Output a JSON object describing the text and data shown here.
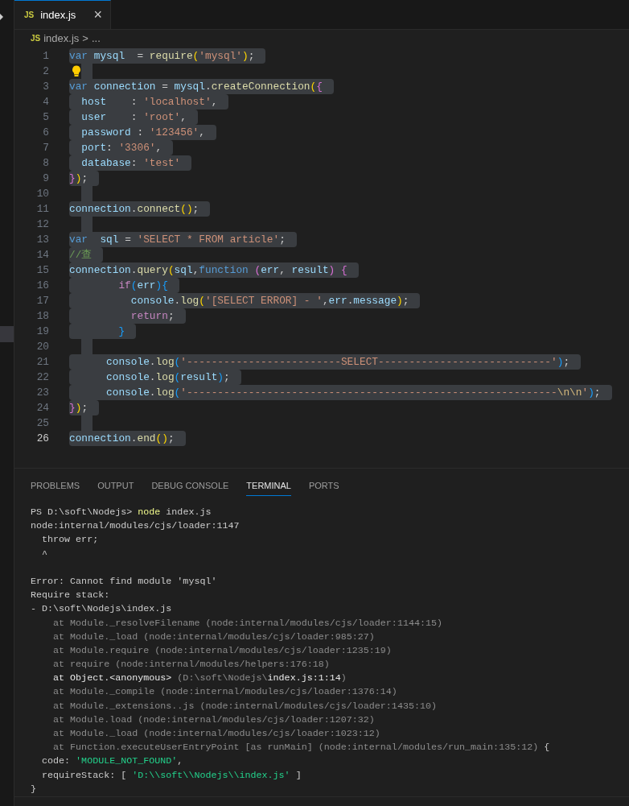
{
  "tab": {
    "label": "index.js",
    "badge": "JS",
    "close": "×",
    "selected": true
  },
  "breadcrumb": {
    "badge": "JS",
    "file": "index.js",
    "sep": ">",
    "rest": "..."
  },
  "editor": {
    "selection": true,
    "lines": [
      {
        "n": "1",
        "active": false,
        "t": [
          {
            "kind": "kw",
            "text": "var "
          },
          {
            "kind": "var",
            "text": "mysql"
          },
          {
            "kind": "p",
            "text": "  = "
          },
          {
            "kind": "fn",
            "text": "require"
          },
          {
            "kind": "b1",
            "text": "("
          },
          {
            "kind": "str",
            "text": "'mysql'"
          },
          {
            "kind": "b1",
            "text": ")"
          },
          {
            "kind": "p",
            "text": ";"
          }
        ]
      },
      {
        "n": "2",
        "active": false,
        "lightbulb": true
      },
      {
        "n": "3",
        "active": false,
        "t": [
          {
            "kind": "kw",
            "text": "var "
          },
          {
            "kind": "var",
            "text": "connection"
          },
          {
            "kind": "p",
            "text": " = "
          },
          {
            "kind": "var",
            "text": "mysql"
          },
          {
            "kind": "p",
            "text": "."
          },
          {
            "kind": "fn",
            "text": "createConnection"
          },
          {
            "kind": "b1",
            "text": "("
          },
          {
            "kind": "b2",
            "text": "{"
          }
        ]
      },
      {
        "n": "4",
        "active": false,
        "t": [
          {
            "kind": "var",
            "text": "  host"
          },
          {
            "kind": "p",
            "text": "    : "
          },
          {
            "kind": "str",
            "text": "'localhost'"
          },
          {
            "kind": "p",
            "text": ","
          }
        ]
      },
      {
        "n": "5",
        "active": false,
        "t": [
          {
            "kind": "var",
            "text": "  user"
          },
          {
            "kind": "p",
            "text": "    : "
          },
          {
            "kind": "str",
            "text": "'root'"
          },
          {
            "kind": "p",
            "text": ","
          }
        ]
      },
      {
        "n": "6",
        "active": false,
        "t": [
          {
            "kind": "var",
            "text": "  password"
          },
          {
            "kind": "p",
            "text": " : "
          },
          {
            "kind": "str",
            "text": "'123456'"
          },
          {
            "kind": "p",
            "text": ","
          }
        ]
      },
      {
        "n": "7",
        "active": false,
        "t": [
          {
            "kind": "var",
            "text": "  port"
          },
          {
            "kind": "p",
            "text": ": "
          },
          {
            "kind": "str",
            "text": "'3306'"
          },
          {
            "kind": "p",
            "text": ","
          }
        ]
      },
      {
        "n": "8",
        "active": false,
        "t": [
          {
            "kind": "var",
            "text": "  database"
          },
          {
            "kind": "p",
            "text": ": "
          },
          {
            "kind": "str",
            "text": "'test'"
          }
        ]
      },
      {
        "n": "9",
        "active": false,
        "t": [
          {
            "kind": "b2",
            "text": "}"
          },
          {
            "kind": "b1",
            "text": ")"
          },
          {
            "kind": "p",
            "text": ";"
          }
        ]
      },
      {
        "n": "10",
        "active": false
      },
      {
        "n": "11",
        "active": false,
        "t": [
          {
            "kind": "var",
            "text": "connection"
          },
          {
            "kind": "p",
            "text": "."
          },
          {
            "kind": "fn",
            "text": "connect"
          },
          {
            "kind": "b1",
            "text": "()"
          },
          {
            "kind": "p",
            "text": ";"
          }
        ]
      },
      {
        "n": "12",
        "active": false
      },
      {
        "n": "13",
        "active": false,
        "t": [
          {
            "kind": "kw",
            "text": "var  "
          },
          {
            "kind": "var",
            "text": "sql"
          },
          {
            "kind": "p",
            "text": " = "
          },
          {
            "kind": "str",
            "text": "'SELECT * FROM article'"
          },
          {
            "kind": "p",
            "text": ";"
          }
        ]
      },
      {
        "n": "14",
        "active": false,
        "t": [
          {
            "kind": "cmt",
            "text": "//查"
          }
        ]
      },
      {
        "n": "15",
        "active": false,
        "t": [
          {
            "kind": "var",
            "text": "connection"
          },
          {
            "kind": "p",
            "text": "."
          },
          {
            "kind": "fn",
            "text": "query"
          },
          {
            "kind": "b1",
            "text": "("
          },
          {
            "kind": "var",
            "text": "sql"
          },
          {
            "kind": "p",
            "text": ","
          },
          {
            "kind": "kw",
            "text": "function "
          },
          {
            "kind": "b2",
            "text": "("
          },
          {
            "kind": "var",
            "text": "err"
          },
          {
            "kind": "p",
            "text": ", "
          },
          {
            "kind": "var",
            "text": "result"
          },
          {
            "kind": "b2",
            "text": ") {"
          }
        ]
      },
      {
        "n": "16",
        "active": false,
        "t": [
          {
            "kind": "ctl",
            "text": "        if"
          },
          {
            "kind": "b3",
            "text": "("
          },
          {
            "kind": "var",
            "text": "err"
          },
          {
            "kind": "b3",
            "text": "){"
          }
        ]
      },
      {
        "n": "17",
        "active": false,
        "t": [
          {
            "kind": "var",
            "text": "          console"
          },
          {
            "kind": "p",
            "text": "."
          },
          {
            "kind": "fn",
            "text": "log"
          },
          {
            "kind": "b1",
            "text": "("
          },
          {
            "kind": "str",
            "text": "'[SELECT ERROR] - '"
          },
          {
            "kind": "p",
            "text": ","
          },
          {
            "kind": "var",
            "text": "err"
          },
          {
            "kind": "p",
            "text": "."
          },
          {
            "kind": "var",
            "text": "message"
          },
          {
            "kind": "b1",
            "text": ")"
          },
          {
            "kind": "p",
            "text": ";"
          }
        ]
      },
      {
        "n": "18",
        "active": false,
        "t": [
          {
            "kind": "ctl",
            "text": "          return"
          },
          {
            "kind": "p",
            "text": ";"
          }
        ]
      },
      {
        "n": "19",
        "active": false,
        "t": [
          {
            "kind": "b3",
            "text": "        }"
          }
        ]
      },
      {
        "n": "20",
        "active": false
      },
      {
        "n": "21",
        "active": false,
        "t": [
          {
            "kind": "var",
            "text": "      console"
          },
          {
            "kind": "p",
            "text": "."
          },
          {
            "kind": "fn",
            "text": "log"
          },
          {
            "kind": "b3",
            "text": "("
          },
          {
            "kind": "str",
            "text": "'-------------------------SELECT----------------------------'"
          },
          {
            "kind": "b3",
            "text": ")"
          },
          {
            "kind": "p",
            "text": ";"
          }
        ]
      },
      {
        "n": "22",
        "active": false,
        "t": [
          {
            "kind": "var",
            "text": "      console"
          },
          {
            "kind": "p",
            "text": "."
          },
          {
            "kind": "fn",
            "text": "log"
          },
          {
            "kind": "b3",
            "text": "("
          },
          {
            "kind": "var",
            "text": "result"
          },
          {
            "kind": "b3",
            "text": ")"
          },
          {
            "kind": "p",
            "text": ";"
          }
        ]
      },
      {
        "n": "23",
        "active": false,
        "t": [
          {
            "kind": "var",
            "text": "      console"
          },
          {
            "kind": "p",
            "text": "."
          },
          {
            "kind": "fn",
            "text": "log"
          },
          {
            "kind": "b3",
            "text": "("
          },
          {
            "kind": "str",
            "text": "'------------------------------------------------------------"
          },
          {
            "kind": "esc",
            "text": "\\n\\n"
          },
          {
            "kind": "str",
            "text": "'"
          },
          {
            "kind": "b3",
            "text": ")"
          },
          {
            "kind": "p",
            "text": ";"
          }
        ]
      },
      {
        "n": "24",
        "active": false,
        "t": [
          {
            "kind": "b2",
            "text": "}"
          },
          {
            "kind": "b1",
            "text": ")"
          },
          {
            "kind": "p",
            "text": ";"
          }
        ]
      },
      {
        "n": "25",
        "active": false
      },
      {
        "n": "26",
        "active": true,
        "t": [
          {
            "kind": "var",
            "text": "connection"
          },
          {
            "kind": "p",
            "text": "."
          },
          {
            "kind": "fn",
            "text": "end"
          },
          {
            "kind": "b1",
            "text": "()"
          },
          {
            "kind": "p",
            "text": ";"
          }
        ]
      }
    ]
  },
  "panel_tabs": [
    {
      "label": "PROBLEMS",
      "selected": false
    },
    {
      "label": "OUTPUT",
      "selected": false
    },
    {
      "label": "DEBUG CONSOLE",
      "selected": false
    },
    {
      "label": "TERMINAL",
      "selected": true
    },
    {
      "label": "PORTS",
      "selected": false
    }
  ],
  "terminal": [
    {
      "kind": "text",
      "t": [
        {
          "kind": "plain",
          "text": "PS D:\\soft\\Nodejs> "
        },
        {
          "kind": "cmd",
          "text": "node"
        },
        {
          "kind": "plain",
          "text": " index.js"
        }
      ]
    },
    {
      "kind": "text",
      "t": [
        {
          "kind": "plain",
          "text": "node:internal/modules/cjs/loader:1147"
        }
      ]
    },
    {
      "kind": "text",
      "t": [
        {
          "kind": "plain",
          "text": "  throw err;"
        }
      ]
    },
    {
      "kind": "text",
      "t": [
        {
          "kind": "plain",
          "text": "  ^"
        }
      ]
    },
    {
      "kind": "blank"
    },
    {
      "kind": "text",
      "t": [
        {
          "kind": "plain",
          "text": "Error: Cannot find module 'mysql'"
        }
      ]
    },
    {
      "kind": "text",
      "t": [
        {
          "kind": "plain",
          "text": "Require stack:"
        }
      ]
    },
    {
      "kind": "text",
      "t": [
        {
          "kind": "plain",
          "text": "- D:\\soft\\Nodejs\\index.js"
        }
      ]
    },
    {
      "kind": "text",
      "t": [
        {
          "kind": "dim",
          "text": "    at Module._resolveFilename (node:internal/modules/cjs/loader:1144:15)"
        }
      ]
    },
    {
      "kind": "text",
      "t": [
        {
          "kind": "dim",
          "text": "    at Module._load (node:internal/modules/cjs/loader:985:27)"
        }
      ]
    },
    {
      "kind": "text",
      "t": [
        {
          "kind": "dim",
          "text": "    at Module.require (node:internal/modules/cjs/loader:1235:19)"
        }
      ]
    },
    {
      "kind": "text",
      "t": [
        {
          "kind": "dim",
          "text": "    at require (node:internal/modules/helpers:176:18)"
        }
      ]
    },
    {
      "kind": "text",
      "t": [
        {
          "kind": "bright",
          "text": "    at Object.<anonymous> "
        },
        {
          "kind": "dim",
          "text": "(D:\\soft\\Nodejs\\"
        },
        {
          "kind": "bright",
          "text": "index.js:1:14"
        },
        {
          "kind": "dim",
          "text": ")"
        }
      ]
    },
    {
      "kind": "text",
      "t": [
        {
          "kind": "dim",
          "text": "    at Module._compile (node:internal/modules/cjs/loader:1376:14)"
        }
      ]
    },
    {
      "kind": "text",
      "t": [
        {
          "kind": "dim",
          "text": "    at Module._extensions..js (node:internal/modules/cjs/loader:1435:10)"
        }
      ]
    },
    {
      "kind": "text",
      "t": [
        {
          "kind": "dim",
          "text": "    at Module.load (node:internal/modules/cjs/loader:1207:32)"
        }
      ]
    },
    {
      "kind": "text",
      "t": [
        {
          "kind": "dim",
          "text": "    at Module._load (node:internal/modules/cjs/loader:1023:12)"
        }
      ]
    },
    {
      "kind": "text",
      "t": [
        {
          "kind": "dim",
          "text": "    at Function.executeUserEntryPoint [as runMain] (node:internal/modules/run_main:135:12)"
        },
        {
          "kind": "plain",
          "text": " {"
        }
      ]
    },
    {
      "kind": "text",
      "t": [
        {
          "kind": "plain",
          "text": "  code: "
        },
        {
          "kind": "str",
          "text": "'MODULE_NOT_FOUND'"
        },
        {
          "kind": "plain",
          "text": ","
        }
      ]
    },
    {
      "kind": "text",
      "t": [
        {
          "kind": "plain",
          "text": "  requireStack: [ "
        },
        {
          "kind": "str",
          "text": "'D:\\\\soft\\\\Nodejs\\\\index.js'"
        },
        {
          "kind": "plain",
          "text": " ]"
        }
      ]
    },
    {
      "kind": "text",
      "t": [
        {
          "kind": "plain",
          "text": "}"
        }
      ]
    }
  ]
}
